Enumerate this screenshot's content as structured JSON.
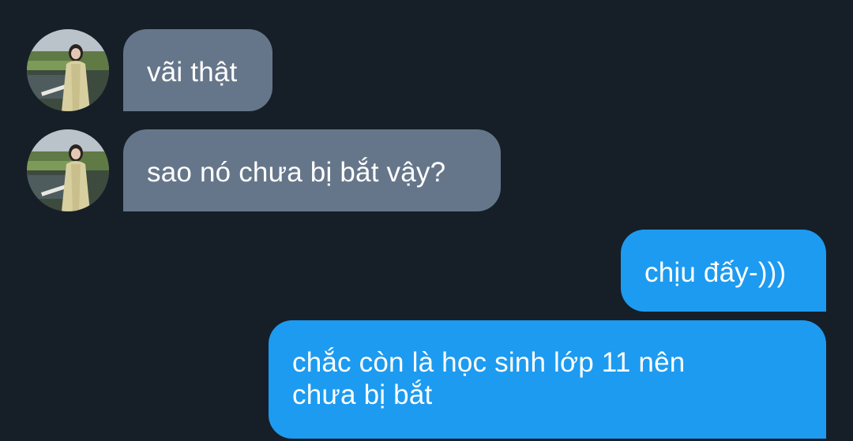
{
  "conversation": {
    "messages": [
      {
        "direction": "incoming",
        "text": "vãi thật"
      },
      {
        "direction": "incoming",
        "text": "sao nó chưa bị bắt vậy?"
      },
      {
        "direction": "outgoing",
        "text": "chịu đấy-)))"
      },
      {
        "direction": "outgoing",
        "lines": [
          "chắc còn là học sinh lớp 11 nên",
          "chưa bị bắt"
        ]
      }
    ]
  },
  "colors": {
    "background": "#161f28",
    "incoming_bubble": "#66768a",
    "outgoing_bubble": "#1d9bf0",
    "text": "#ffffff"
  },
  "icons": {
    "avatar": "contact-avatar-photo"
  }
}
